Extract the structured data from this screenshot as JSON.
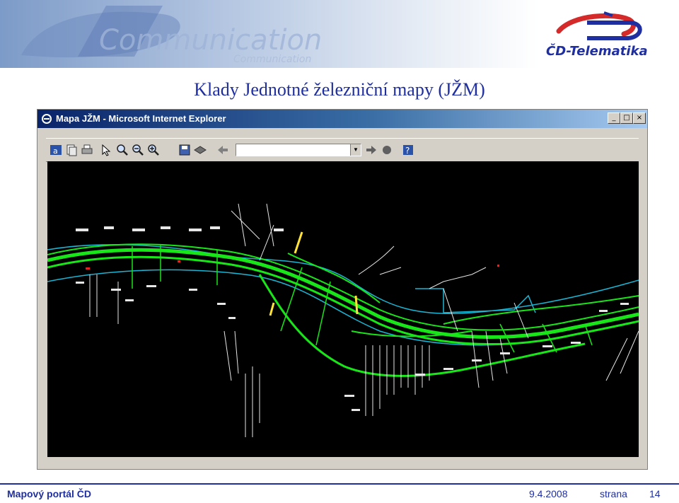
{
  "slide": {
    "title": "Klady Jednotné železniční mapy (JŽM)",
    "banner_text": "Communication",
    "banner_subtext": "Communication",
    "logo_text": "ČD-Telematika"
  },
  "browser": {
    "title": "Mapa JŽM - Microsoft Internet Explorer",
    "caption_buttons": {
      "minimize": "_",
      "maximize": "□",
      "close": "×"
    },
    "toolbar_icons": [
      "app-icon",
      "copy-icon",
      "print-icon",
      "select-icon",
      "zoom-window-icon",
      "zoom-out-icon",
      "zoom-in-icon",
      "save-icon",
      "layers-icon",
      "back-arrow-icon",
      "forward-arrow-icon",
      "stop-icon",
      "help-icon"
    ]
  },
  "footer": {
    "left": "Mapový portál ČD",
    "date": "9.4.2008",
    "page_label": "strana",
    "page_number": "14"
  },
  "colors": {
    "title_blue": "#1f2fa0",
    "logo_red": "#d42a2a",
    "map_background": "#000000",
    "track_green": "#19e619",
    "river_cyan": "#1bb5d4"
  }
}
